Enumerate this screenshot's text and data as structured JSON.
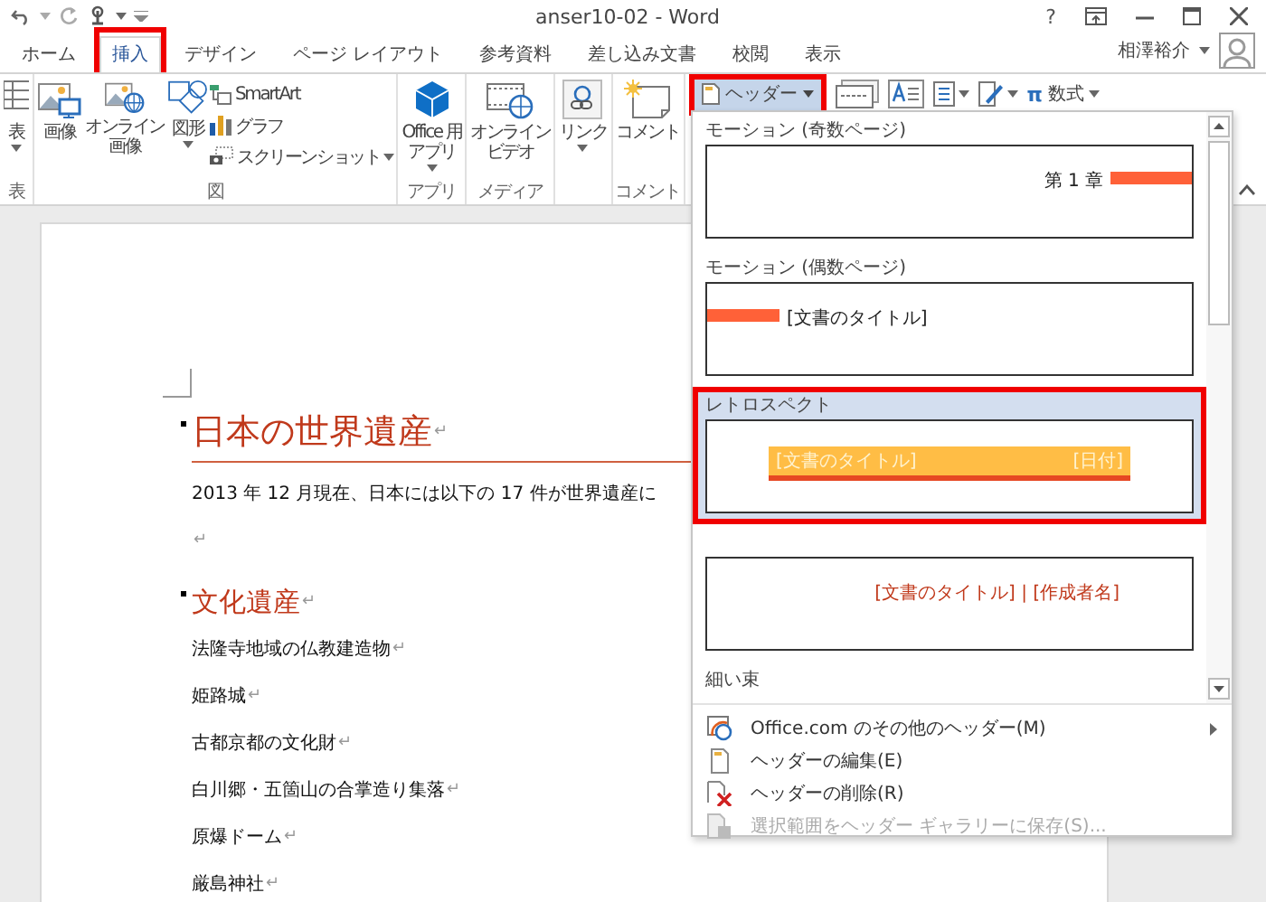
{
  "window": {
    "title": "anser10-02 - Word",
    "help": "?"
  },
  "tabs": [
    {
      "label": "ホーム",
      "selected": false,
      "highlighted": false
    },
    {
      "label": "挿入",
      "selected": true,
      "highlighted": true
    },
    {
      "label": "デザイン",
      "selected": false,
      "highlighted": false
    },
    {
      "label": "ページ レイアウト",
      "selected": false,
      "highlighted": false
    },
    {
      "label": "参考資料",
      "selected": false,
      "highlighted": false
    },
    {
      "label": "差し込み文書",
      "selected": false,
      "highlighted": false
    },
    {
      "label": "校閲",
      "selected": false,
      "highlighted": false
    },
    {
      "label": "表示",
      "selected": false,
      "highlighted": false
    }
  ],
  "user": {
    "name": "相澤裕介"
  },
  "ribbon": {
    "groups": [
      {
        "label": "表",
        "buttons": [
          {
            "lines": [
              "表"
            ],
            "dropdown": true
          }
        ]
      },
      {
        "label": "図",
        "buttons": [
          {
            "lines": [
              "画像"
            ],
            "dropdown": false
          },
          {
            "lines": [
              "オンライン",
              "画像"
            ],
            "dropdown": false
          },
          {
            "lines": [
              "図形"
            ],
            "dropdown": true
          }
        ],
        "small_buttons": [
          {
            "label": "SmartArt",
            "dropdown": false
          },
          {
            "label": "グラフ",
            "dropdown": false
          },
          {
            "label": "スクリーンショット",
            "dropdown": true
          }
        ]
      },
      {
        "label": "アプリ",
        "buttons": [
          {
            "lines": [
              "Office 用",
              "アプリ"
            ],
            "dropdown": true
          }
        ]
      },
      {
        "label": "メディア",
        "buttons": [
          {
            "lines": [
              "オンライン",
              "ビデオ"
            ],
            "dropdown": false
          }
        ]
      },
      {
        "buttons": [
          {
            "lines": [
              "リンク"
            ],
            "dropdown": true
          }
        ]
      },
      {
        "label": "コメント",
        "buttons": [
          {
            "lines": [
              "コメント"
            ],
            "dropdown": false
          }
        ]
      }
    ],
    "header_button": {
      "label": "ヘッダー",
      "dropdown": true,
      "pressed": true,
      "highlighted": true
    },
    "tools": [
      {
        "dropdown": false
      },
      {
        "dropdown": false
      },
      {
        "dropdown": true
      },
      {
        "dropdown": true
      }
    ],
    "equation": {
      "symbol": "π",
      "label": "数式",
      "dropdown": true
    }
  },
  "document": {
    "title": {
      "text": "日本の世界遺産",
      "mark": "↵"
    },
    "paragraphs": [
      {
        "kind": "body",
        "text": "2013 年 12 月現在、日本には以下の 17 件が世界遺産に"
      },
      {
        "kind": "empty",
        "mark": "↵"
      },
      {
        "kind": "heading",
        "text": "文化遺産",
        "mark": "↵"
      },
      {
        "kind": "body",
        "text": "法隆寺地域の仏教建造物",
        "mark": "↵"
      },
      {
        "kind": "body",
        "text": "姫路城",
        "mark": "↵"
      },
      {
        "kind": "body",
        "text": "古都京都の文化財",
        "mark": "↵"
      },
      {
        "kind": "body",
        "text": "白川郷・五箇山の合掌造り集落",
        "mark": "↵"
      },
      {
        "kind": "body",
        "text": "原爆ドーム",
        "mark": "↵"
      },
      {
        "kind": "body",
        "text": "厳島神社",
        "mark": "↵"
      }
    ]
  },
  "header_gallery": {
    "items": [
      {
        "kind": "motion-odd",
        "label": "モーション (奇数ページ)",
        "selected": false,
        "highlighted": false,
        "preview_texts": [
          "第 1 章"
        ]
      },
      {
        "kind": "motion-even",
        "label": "モーション (偶数ページ)",
        "selected": false,
        "highlighted": false,
        "preview_texts": [
          "[文書のタイトル]"
        ]
      },
      {
        "kind": "retrospect",
        "label": "レトロスペクト",
        "selected": true,
        "highlighted": true,
        "preview_texts": [
          "[文書のタイトル]",
          "[日付]"
        ]
      },
      {
        "kind": "lines",
        "selected": false,
        "highlighted": false,
        "preview_texts": [
          "[文書のタイトル] | [作成者名]"
        ]
      },
      {
        "kind": "label-only",
        "label": "細い束",
        "selected": false,
        "highlighted": false
      }
    ],
    "menu": [
      {
        "label": "Office.com のその他のヘッダー(M)",
        "disabled": false,
        "submenu": true
      },
      {
        "label": "ヘッダーの編集(E)",
        "disabled": false,
        "submenu": false
      },
      {
        "label": "ヘッダーの削除(R)",
        "disabled": false,
        "submenu": false
      },
      {
        "label": "選択範囲をヘッダー ギャラリーに保存(S)...",
        "disabled": true,
        "submenu": false
      }
    ]
  }
}
